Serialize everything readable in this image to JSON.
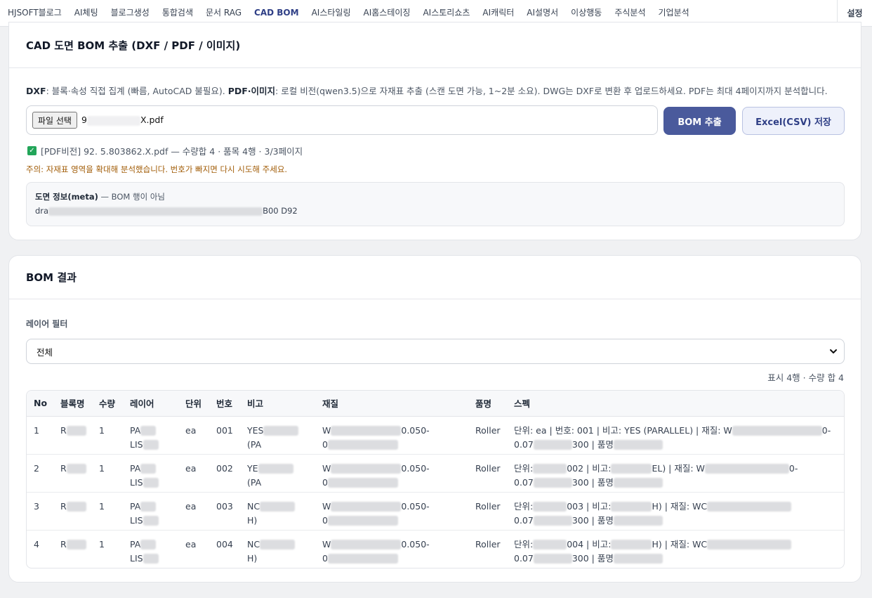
{
  "nav": {
    "tabs": [
      "HJSOFT블로그",
      "AI체팅",
      "블로그생성",
      "통합검색",
      "문서 RAG",
      "CAD BOM",
      "AI스타일링",
      "AI홈스테이징",
      "AI스토리쇼츠",
      "AI캐릭터",
      "AI설명서",
      "이상행동",
      "주식분석",
      "기업분석"
    ],
    "active_index": 5,
    "settings": "설정"
  },
  "extract": {
    "title": "CAD 도면 BOM 추출 (DXF / PDF / 이미지)",
    "desc_dxf_label": "DXF",
    "desc_dxf_text": ": 블록·속성 직접 집계 (빠름, AutoCAD 불필요). ",
    "desc_pdf_label": "PDF·이미지",
    "desc_pdf_text": ": 로컬 비전(qwen3.5)으로 자재표 추출 (스캔 도면 가능, 1~2분 소요). DWG는 DXF로 변환 후 업로드하세요. PDF는 최대 4페이지까지 분석합니다.",
    "file_button": "파일 선택",
    "file_name_prefix": "9",
    "file_name_suffix": "X.pdf",
    "bom_button": "BOM 추출",
    "excel_button": "Excel(CSV) 저장",
    "status_text": "[PDF비전] 92. 5.803862.X.pdf — 수량합 4 · 품목 4행 · 3/3페이지",
    "warning": "주의: 자재표 영역을 확대해 분석했습니다. 번호가 빠지면 다시 시도해 주세요.",
    "meta_title": "도면 정보(meta)",
    "meta_title_suffix": " — BOM 행이 아님",
    "meta_prefix": "dra",
    "meta_suffix": "B00 D92"
  },
  "result": {
    "title": "BOM 결과",
    "filter_label": "레이어 필터",
    "filter_value": "전체",
    "summary": "표시 4행 · 수량 합 4",
    "columns": [
      "No",
      "블록명",
      "수량",
      "레이어",
      "단위",
      "번호",
      "비고",
      "재질",
      "품명",
      "스펙"
    ],
    "rows": [
      {
        "no": "1",
        "block": "R",
        "qty": "1",
        "layer1": "PA",
        "layer2": "LIS",
        "unit": "ea",
        "num": "001",
        "note1": "YES",
        "note2": "(PA",
        "mat1": "W",
        "mat1b": "0.050-",
        "mat2": "0",
        "name": "Roller",
        "spec1": "단위: ea | 번호: 001 | 비고: YES (PARALLEL) | 재질: W",
        "spec1b": "0-",
        "spec2a": "0.07",
        "spec2b": "300 | 품명"
      },
      {
        "no": "2",
        "block": "R",
        "qty": "1",
        "layer1": "PA",
        "layer2": "LIS",
        "unit": "ea",
        "num": "002",
        "note1": "YE",
        "note2": "(PA",
        "mat1": "W",
        "mat1b": "0.050-",
        "mat2": "0",
        "name": "Roller",
        "spec1": "단위:",
        "spec1m": "002 | 비고:",
        "spec1n": "EL) | 재질: W",
        "spec1b": "0-",
        "spec2a": "0.07",
        "spec2b": "300 | 품명"
      },
      {
        "no": "3",
        "block": "R",
        "qty": "1",
        "layer1": "PA",
        "layer2": "LIS",
        "unit": "ea",
        "num": "003",
        "note1": "NC",
        "note2": "H)",
        "mat1": "W",
        "mat1b": "0.050-",
        "mat2": "0",
        "name": "Roller",
        "spec1": "단위:",
        "spec1m": "003 | 비고:",
        "spec1n": "H) | 재질: WC",
        "spec1b": "",
        "spec2a": "0.07",
        "spec2b": "300 | 품명"
      },
      {
        "no": "4",
        "block": "R",
        "qty": "1",
        "layer1": "PA",
        "layer2": "LIS",
        "unit": "ea",
        "num": "004",
        "note1": "NC",
        "note2": "H)",
        "mat1": "W",
        "mat1b": "0.050-",
        "mat2": "0",
        "name": "Roller",
        "spec1": "단위:",
        "spec1m": "004 | 비고:",
        "spec1n": "H) | 재질: WC",
        "spec1b": "",
        "spec2a": "0.07",
        "spec2b": "300 | 품명"
      }
    ]
  }
}
